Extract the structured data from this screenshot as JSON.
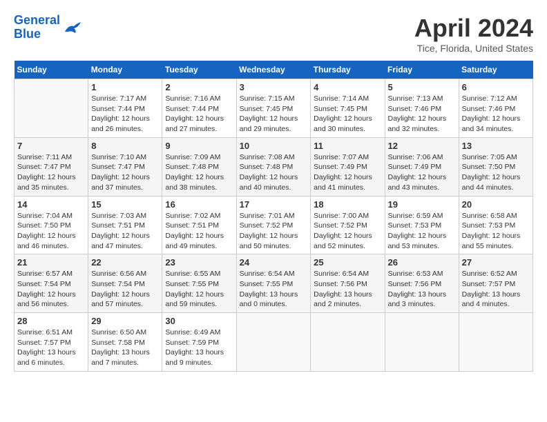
{
  "header": {
    "logo_line1": "General",
    "logo_line2": "Blue",
    "month_title": "April 2024",
    "location": "Tice, Florida, United States"
  },
  "calendar": {
    "weekdays": [
      "Sunday",
      "Monday",
      "Tuesday",
      "Wednesday",
      "Thursday",
      "Friday",
      "Saturday"
    ],
    "weeks": [
      [
        {
          "day": "",
          "info": ""
        },
        {
          "day": "1",
          "info": "Sunrise: 7:17 AM\nSunset: 7:44 PM\nDaylight: 12 hours\nand 26 minutes."
        },
        {
          "day": "2",
          "info": "Sunrise: 7:16 AM\nSunset: 7:44 PM\nDaylight: 12 hours\nand 27 minutes."
        },
        {
          "day": "3",
          "info": "Sunrise: 7:15 AM\nSunset: 7:45 PM\nDaylight: 12 hours\nand 29 minutes."
        },
        {
          "day": "4",
          "info": "Sunrise: 7:14 AM\nSunset: 7:45 PM\nDaylight: 12 hours\nand 30 minutes."
        },
        {
          "day": "5",
          "info": "Sunrise: 7:13 AM\nSunset: 7:46 PM\nDaylight: 12 hours\nand 32 minutes."
        },
        {
          "day": "6",
          "info": "Sunrise: 7:12 AM\nSunset: 7:46 PM\nDaylight: 12 hours\nand 34 minutes."
        }
      ],
      [
        {
          "day": "7",
          "info": "Sunrise: 7:11 AM\nSunset: 7:47 PM\nDaylight: 12 hours\nand 35 minutes."
        },
        {
          "day": "8",
          "info": "Sunrise: 7:10 AM\nSunset: 7:47 PM\nDaylight: 12 hours\nand 37 minutes."
        },
        {
          "day": "9",
          "info": "Sunrise: 7:09 AM\nSunset: 7:48 PM\nDaylight: 12 hours\nand 38 minutes."
        },
        {
          "day": "10",
          "info": "Sunrise: 7:08 AM\nSunset: 7:48 PM\nDaylight: 12 hours\nand 40 minutes."
        },
        {
          "day": "11",
          "info": "Sunrise: 7:07 AM\nSunset: 7:49 PM\nDaylight: 12 hours\nand 41 minutes."
        },
        {
          "day": "12",
          "info": "Sunrise: 7:06 AM\nSunset: 7:49 PM\nDaylight: 12 hours\nand 43 minutes."
        },
        {
          "day": "13",
          "info": "Sunrise: 7:05 AM\nSunset: 7:50 PM\nDaylight: 12 hours\nand 44 minutes."
        }
      ],
      [
        {
          "day": "14",
          "info": "Sunrise: 7:04 AM\nSunset: 7:50 PM\nDaylight: 12 hours\nand 46 minutes."
        },
        {
          "day": "15",
          "info": "Sunrise: 7:03 AM\nSunset: 7:51 PM\nDaylight: 12 hours\nand 47 minutes."
        },
        {
          "day": "16",
          "info": "Sunrise: 7:02 AM\nSunset: 7:51 PM\nDaylight: 12 hours\nand 49 minutes."
        },
        {
          "day": "17",
          "info": "Sunrise: 7:01 AM\nSunset: 7:52 PM\nDaylight: 12 hours\nand 50 minutes."
        },
        {
          "day": "18",
          "info": "Sunrise: 7:00 AM\nSunset: 7:52 PM\nDaylight: 12 hours\nand 52 minutes."
        },
        {
          "day": "19",
          "info": "Sunrise: 6:59 AM\nSunset: 7:53 PM\nDaylight: 12 hours\nand 53 minutes."
        },
        {
          "day": "20",
          "info": "Sunrise: 6:58 AM\nSunset: 7:53 PM\nDaylight: 12 hours\nand 55 minutes."
        }
      ],
      [
        {
          "day": "21",
          "info": "Sunrise: 6:57 AM\nSunset: 7:54 PM\nDaylight: 12 hours\nand 56 minutes."
        },
        {
          "day": "22",
          "info": "Sunrise: 6:56 AM\nSunset: 7:54 PM\nDaylight: 12 hours\nand 57 minutes."
        },
        {
          "day": "23",
          "info": "Sunrise: 6:55 AM\nSunset: 7:55 PM\nDaylight: 12 hours\nand 59 minutes."
        },
        {
          "day": "24",
          "info": "Sunrise: 6:54 AM\nSunset: 7:55 PM\nDaylight: 13 hours\nand 0 minutes."
        },
        {
          "day": "25",
          "info": "Sunrise: 6:54 AM\nSunset: 7:56 PM\nDaylight: 13 hours\nand 2 minutes."
        },
        {
          "day": "26",
          "info": "Sunrise: 6:53 AM\nSunset: 7:56 PM\nDaylight: 13 hours\nand 3 minutes."
        },
        {
          "day": "27",
          "info": "Sunrise: 6:52 AM\nSunset: 7:57 PM\nDaylight: 13 hours\nand 4 minutes."
        }
      ],
      [
        {
          "day": "28",
          "info": "Sunrise: 6:51 AM\nSunset: 7:57 PM\nDaylight: 13 hours\nand 6 minutes."
        },
        {
          "day": "29",
          "info": "Sunrise: 6:50 AM\nSunset: 7:58 PM\nDaylight: 13 hours\nand 7 minutes."
        },
        {
          "day": "30",
          "info": "Sunrise: 6:49 AM\nSunset: 7:59 PM\nDaylight: 13 hours\nand 9 minutes."
        },
        {
          "day": "",
          "info": ""
        },
        {
          "day": "",
          "info": ""
        },
        {
          "day": "",
          "info": ""
        },
        {
          "day": "",
          "info": ""
        }
      ]
    ]
  }
}
